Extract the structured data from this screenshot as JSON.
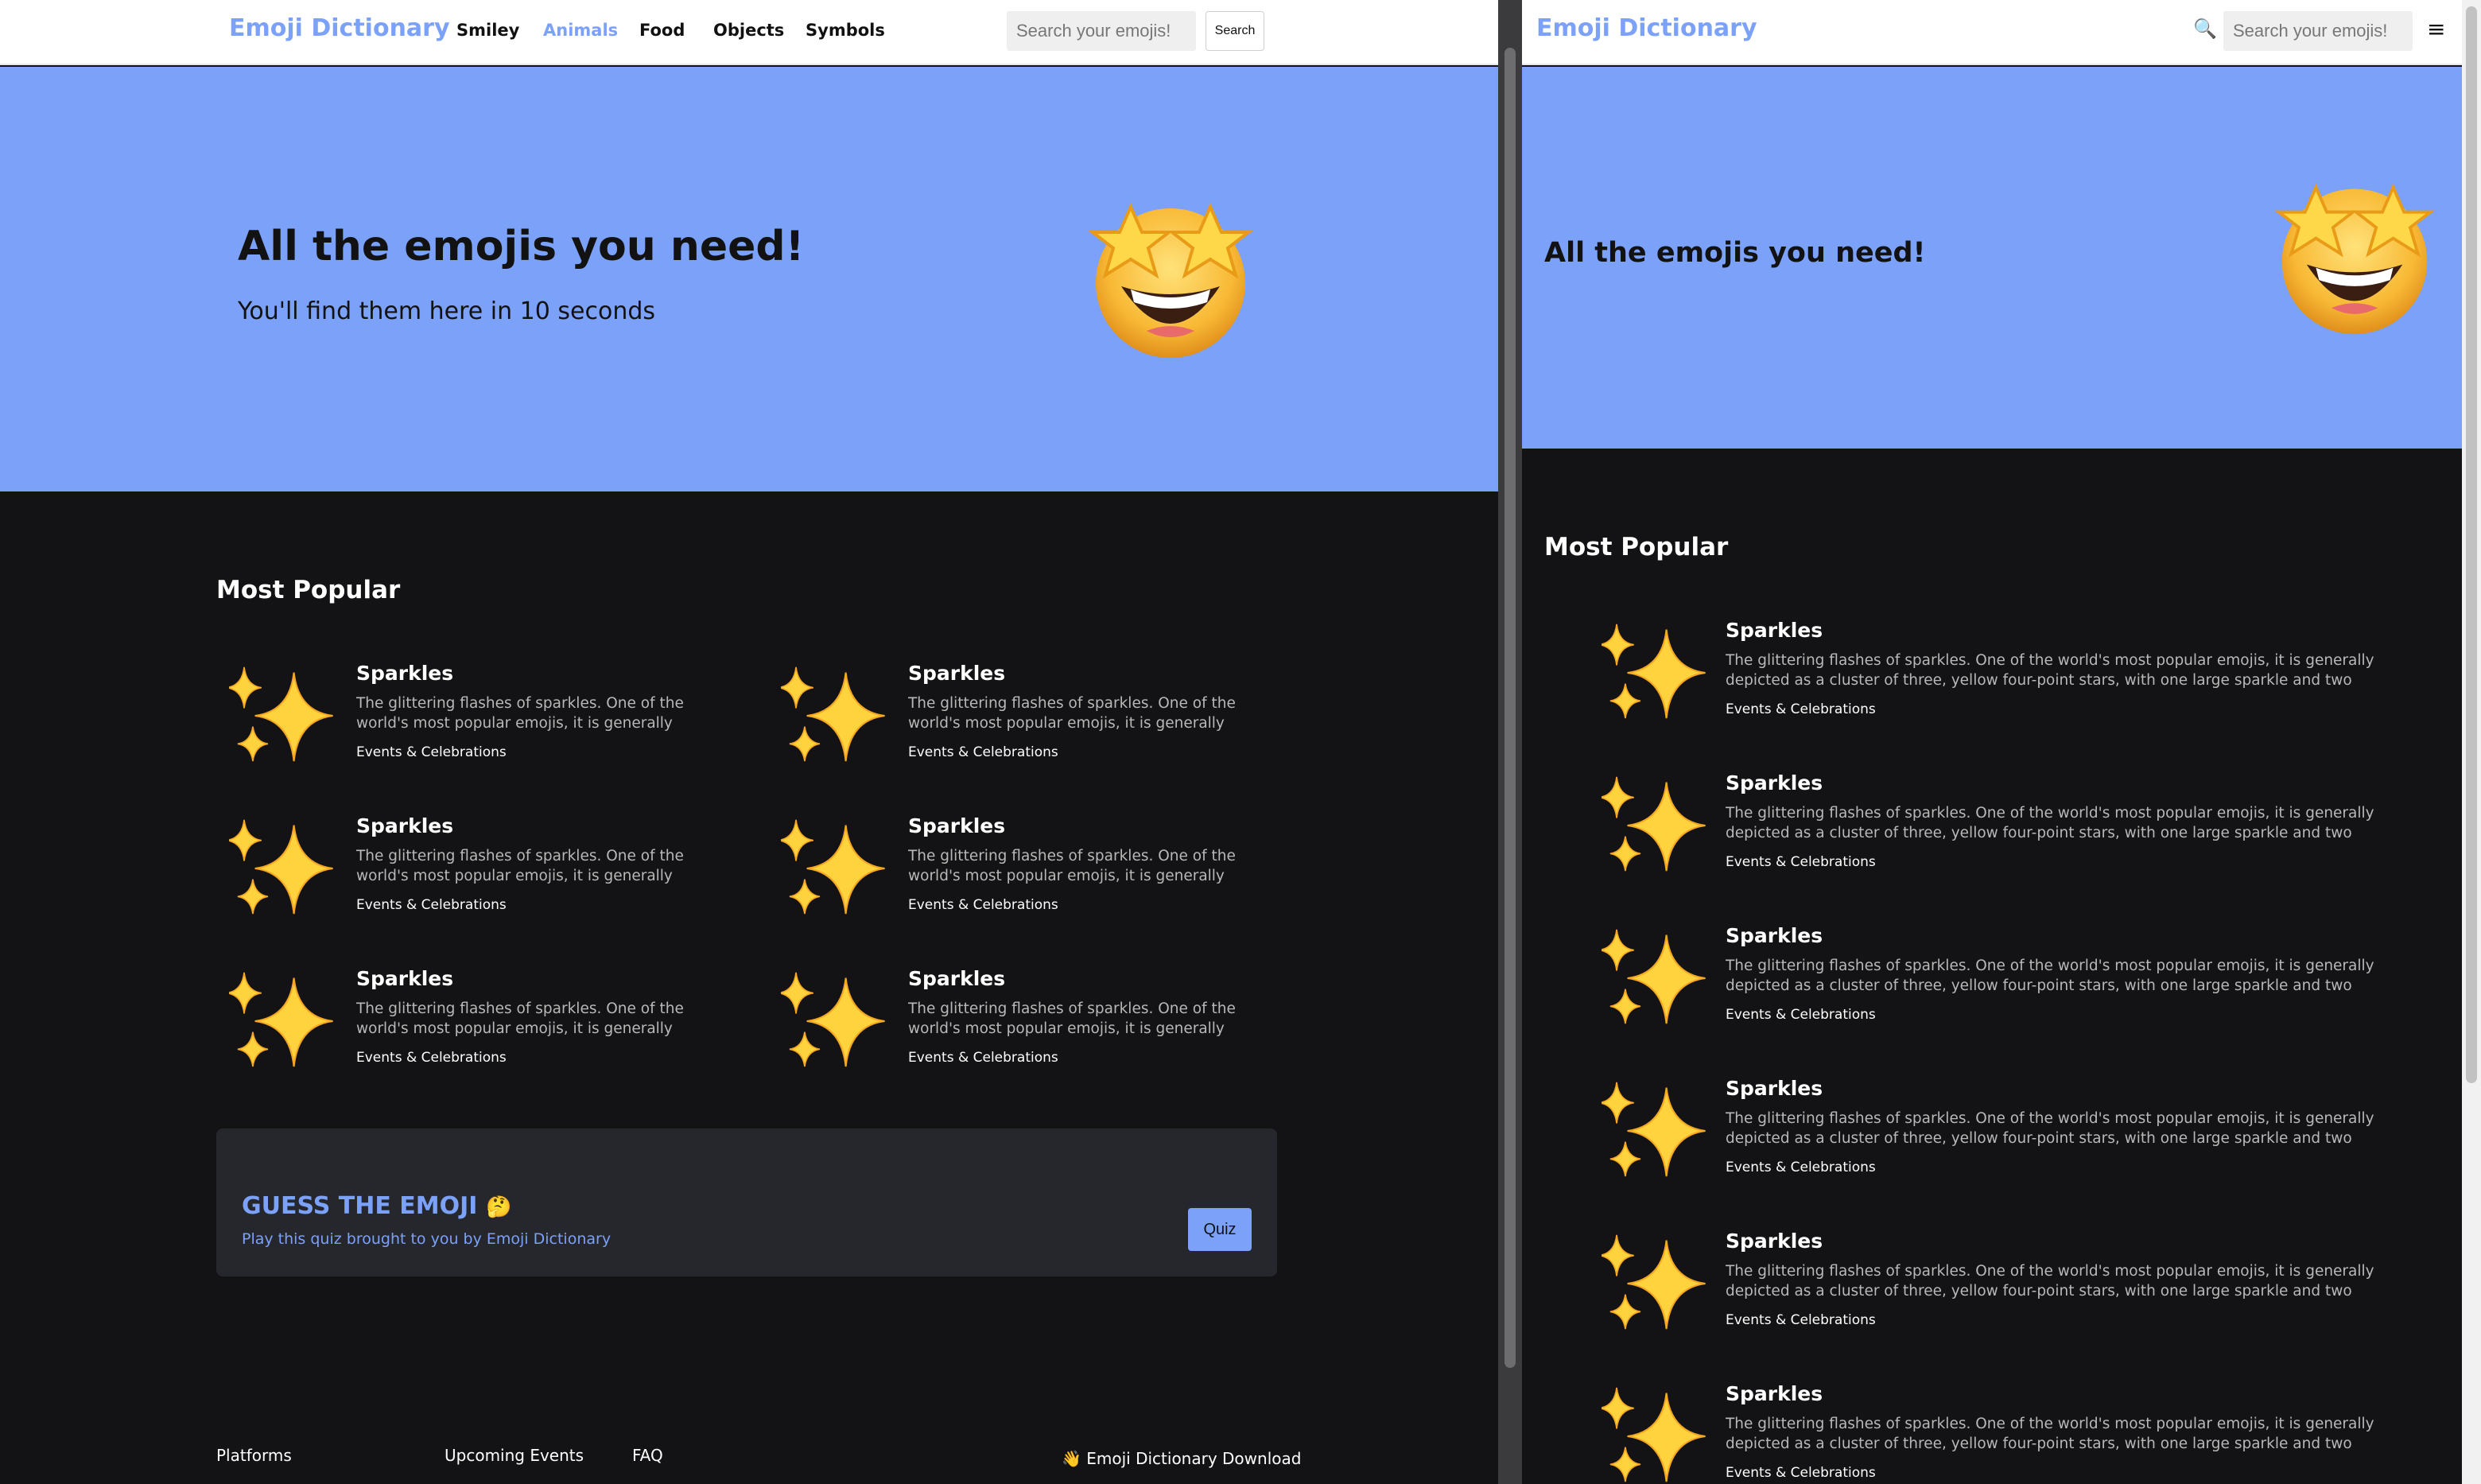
{
  "brand": "Emoji Dictionary",
  "nav_links": [
    "Smiley",
    "Animals",
    "Food",
    "Objects",
    "Symbols"
  ],
  "active_nav": "Animals",
  "search": {
    "placeholder": "Search your emojis!",
    "button": "Search"
  },
  "hero": {
    "title": "All the emojis you need!",
    "subtitle": "You'll find them here in 10 seconds",
    "emoji": "star-struck"
  },
  "popular": {
    "title": "Most Popular",
    "cards": [
      {
        "title": "Sparkles",
        "description": "The glittering flashes of sparkles. One of the world's most popular emojis, it is generally depicted as a cluster of three, yellow four-point stars, with one large sparkle and two small ones to its left",
        "category": "Events & Celebrations"
      },
      {
        "title": "Sparkles",
        "description": "The glittering flashes of sparkles. One of the world's most popular emojis, it is generally depicted as a cluster of three, yellow four-point stars, with one large sparkle and two small ones to its left",
        "category": "Events & Celebrations"
      },
      {
        "title": "Sparkles",
        "description": "The glittering flashes of sparkles. One of the world's most popular emojis, it is generally depicted as a cluster of three, yellow four-point stars, with one large sparkle and two small ones to its left",
        "category": "Events & Celebrations"
      },
      {
        "title": "Sparkles",
        "description": "The glittering flashes of sparkles. One of the world's most popular emojis, it is generally depicted as a cluster of three, yellow four-point stars, with one large sparkle and two small ones to its left",
        "category": "Events & Celebrations"
      },
      {
        "title": "Sparkles",
        "description": "The glittering flashes of sparkles. One of the world's most popular emojis, it is generally depicted as a cluster of three, yellow four-point stars, with one large sparkle and two small ones to its left",
        "category": "Events & Celebrations"
      },
      {
        "title": "Sparkles",
        "description": "The glittering flashes of sparkles. One of the world's most popular emojis, it is generally depicted as a cluster of three, yellow four-point stars, with one large sparkle and two small ones to its left",
        "category": "Events & Celebrations"
      }
    ]
  },
  "quiz": {
    "title": "GUESS THE EMOJI",
    "emoji": "🤔",
    "subtitle": "Play this quiz brought to you by Emoji Dictionary",
    "button": "Quiz"
  },
  "footer": {
    "links": [
      "Platforms",
      "Upcoming Events",
      "FAQ"
    ],
    "download_icon": "👋",
    "download": "Emoji Dictionary Download"
  },
  "mobile": {
    "search_icon": "🔍",
    "menu_icon": "≡"
  },
  "colors": {
    "accent": "#7ba1f8",
    "background": "#131315",
    "card": "#26272c"
  }
}
